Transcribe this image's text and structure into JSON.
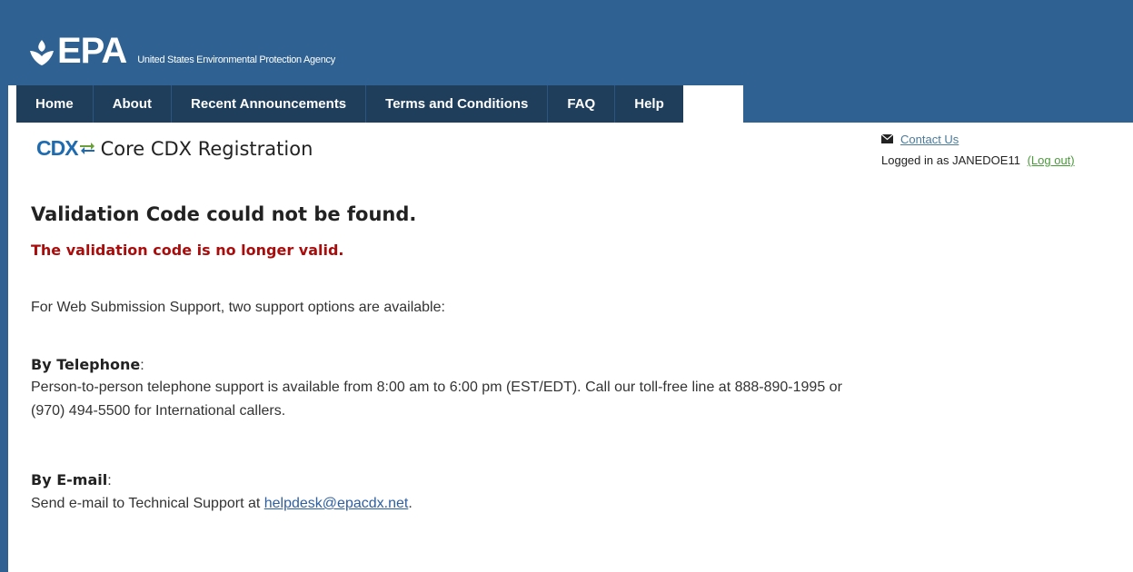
{
  "header": {
    "logo_text": "EPA",
    "agency_name": "United States Environmental Protection Agency"
  },
  "nav": {
    "items": [
      "Home",
      "About",
      "Recent Announcements",
      "Terms and Conditions",
      "FAQ",
      "Help"
    ]
  },
  "app": {
    "logo": "CDX",
    "title": "Core CDX Registration"
  },
  "user": {
    "contact_label": "Contact Us",
    "logged_in_text": "Logged in as JANEDOE11",
    "logout_label": "(Log out)"
  },
  "main": {
    "heading": "Validation Code could not be found.",
    "error": "The validation code is no longer valid.",
    "intro": "For Web Submission Support, two support options are available:",
    "phone_label": "By Telephone",
    "phone_line1": "Person-to-person telephone support is available from 8:00 am to 6:00 pm (EST/EDT). Call our toll-free line at 888-890-1995 or",
    "phone_line2": "(970) 494-5500 for International callers.",
    "email_label": "By E-mail",
    "email_text": "Send e-mail to Technical Support at",
    "email_address": "helpdesk@epacdx.net",
    "email_suffix": "."
  },
  "colors": {
    "header_blue": "#2f6292",
    "nav_dark": "#1e3e5c",
    "error_red": "#aa0c0c",
    "link_blue": "#2e5fa0"
  }
}
